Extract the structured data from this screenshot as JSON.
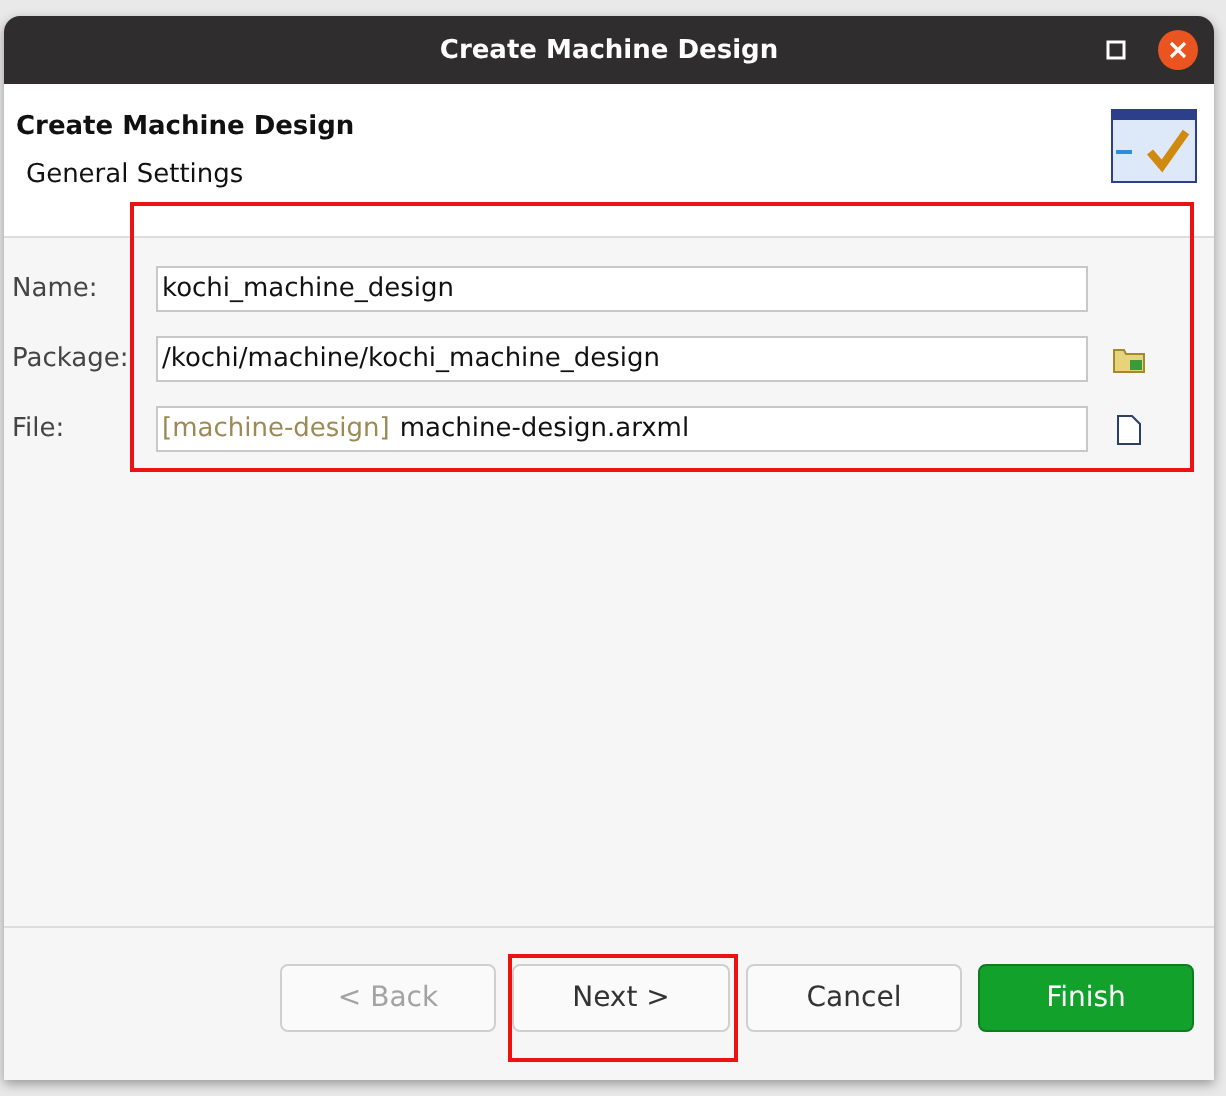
{
  "window": {
    "title": "Create Machine Design"
  },
  "header": {
    "title": "Create Machine Design",
    "subtitle": "General Settings"
  },
  "fields": [
    {
      "kind": "text",
      "label": "Name:",
      "value": "kochi_machine_design"
    },
    {
      "kind": "browse",
      "label": "Package:",
      "value": "/kochi/machine/kochi_machine_design"
    },
    {
      "kind": "file",
      "label": "File:",
      "prefix": "[machine-design]",
      "value": "machine-design.arxml"
    }
  ],
  "buttons": [
    {
      "label": "< Back",
      "disabled": true,
      "kind": "normal"
    },
    {
      "label": "Next >",
      "disabled": false,
      "kind": "normal"
    },
    {
      "label": "Cancel",
      "disabled": false,
      "kind": "normal"
    },
    {
      "label": "Finish",
      "disabled": false,
      "kind": "primary"
    }
  ]
}
